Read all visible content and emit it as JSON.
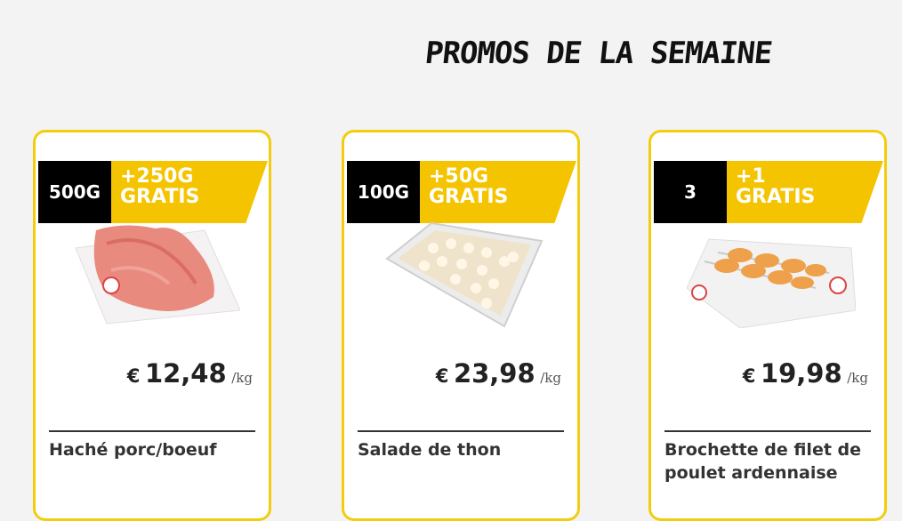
{
  "heading": "PROMOS DE LA SEMAINE",
  "products": [
    {
      "qty": "500G",
      "promo_line1": "+250G",
      "promo_line2": "GRATIS",
      "currency": "€",
      "price": "12,48",
      "unit": "/kg",
      "name": "Haché porc/boeuf"
    },
    {
      "qty": "100G",
      "promo_line1": "+50G",
      "promo_line2": "GRATIS",
      "currency": "€",
      "price": "23,98",
      "unit": "/kg",
      "name": "Salade de thon"
    },
    {
      "qty": "3",
      "promo_line1": "+1",
      "promo_line2": "GRATIS",
      "currency": "€",
      "price": "19,98",
      "unit": "/kg",
      "name": "Brochette de filet de poulet ardennaise"
    }
  ],
  "colors": {
    "accent": "#f5c400",
    "border": "#f2cd0f",
    "badge_dark": "#000000"
  }
}
